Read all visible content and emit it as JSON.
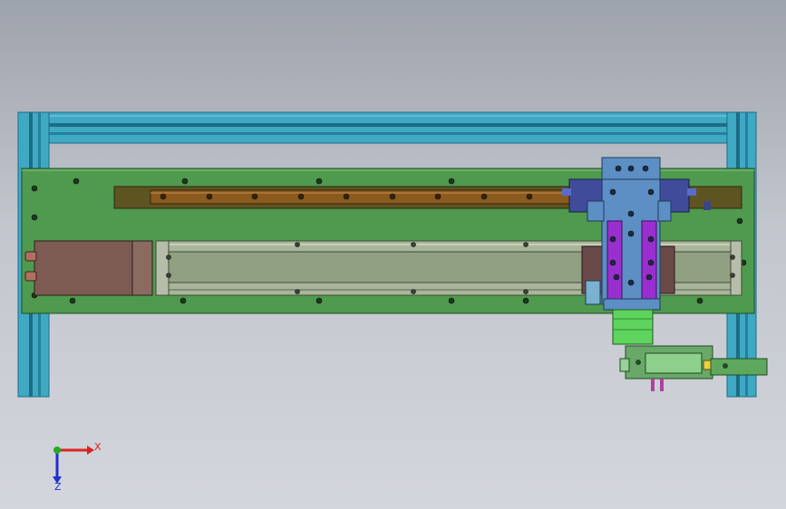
{
  "viewport": {
    "background_top": "#9ea3ad",
    "background_bottom": "#d3d6dc"
  },
  "colors": {
    "frame": "#3fa9c4",
    "frame_dark": "#1d6c86",
    "plate": "#4f9a4f",
    "linear_guide": "#8a5a1f",
    "guide_carrier": "#5e5422",
    "motor": "#7d5a52",
    "actuator_body": "#a9b59a",
    "carriage": "#5d8ec4",
    "carriage_purple": "#9a2fd0",
    "slider_blocks": "#404c9a",
    "gripper": "#6aa86a"
  },
  "triad": {
    "x_label": "X",
    "z_label": "Z",
    "x_color": "#e02020",
    "y_color": "#22aa22",
    "z_color": "#2030d0",
    "x_icon": "x-axis-arrow",
    "y_icon": "y-axis-dot",
    "z_icon": "z-axis-arrow"
  }
}
